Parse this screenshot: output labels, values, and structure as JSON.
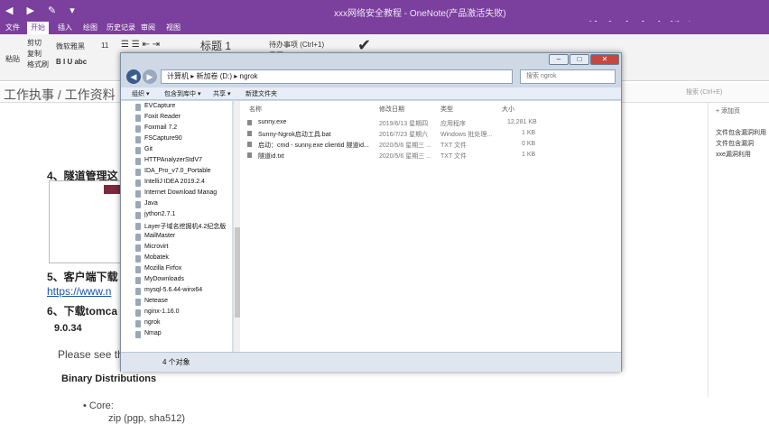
{
  "onenote": {
    "title": "xxx网络安全教程 - OneNote(产品激活失败)",
    "watermark": "网络安全官方教程",
    "tabs": [
      "文件",
      "开始",
      "插入",
      "绘图",
      "历史记录",
      "审阅",
      "视图"
    ],
    "ribbon": {
      "paste": "粘贴",
      "cut": "剪切",
      "copy": "复制",
      "format_painter": "格式刷",
      "font": "微软雅黑",
      "size": "11",
      "heading": "标题 1",
      "todo": "待办事项 (Ctrl+1)",
      "important": "重要"
    },
    "breadcrumb": "工作执事 / 工作资料",
    "search_placeholder": "搜索 (Ctrl+E)",
    "right_pane": {
      "add_page": "+ 添加页",
      "items": [
        "文件包含漏洞利用",
        "文件包含漏洞",
        "xxe漏洞利用"
      ]
    },
    "note": {
      "item4": "4、隧道管理这",
      "item5": "5、客户端下载",
      "link": "https://www.n",
      "item6": "6、下载tomca",
      "version": "9.0.34",
      "please": "Please see the",
      "binary": "Binary Distributions",
      "core": "Core:",
      "zip": "zip (pgp, sha512)"
    }
  },
  "explorer": {
    "address": [
      "计算机",
      "新加卷 (D:)",
      "ngrok"
    ],
    "search_placeholder": "搜索 ngrok",
    "commands": [
      "组织 ▾",
      "包含到库中 ▾",
      "共享 ▾",
      "新建文件夹"
    ],
    "nav_items": [
      "EVCapture",
      "Foxit Reader",
      "Foxmail 7.2",
      "FSCapture90",
      "Git",
      "HTTPAnalyzerStdV7",
      "IDA_Pro_v7.0_Portable",
      "IntelliJ IDEA 2019.2.4",
      "Internet Download Manag",
      "Java",
      "jython2.7.1",
      "Layer子域名挖掘机4.2纪念版",
      "MailMaster",
      "Microvirt",
      "Mobatek",
      "Mozilla Firfox",
      "MyDownloads",
      "mysql-5.6.44-winx64",
      "Netease",
      "nginx-1.16.0",
      "ngrok",
      "Nmap"
    ],
    "columns": {
      "name": "名称",
      "date": "修改日期",
      "type": "类型",
      "size": "大小"
    },
    "files": [
      {
        "name": "sunny.exe",
        "date": "2019/6/13 星期四",
        "type": "应用程序",
        "size": "12,281 KB"
      },
      {
        "name": "Sunny-Ngrok启动工具.bat",
        "date": "2016/7/23 星期六",
        "type": "Windows 批处理...",
        "size": "1 KB"
      },
      {
        "name": "启动：cmd - sunny.exe clientid 隧道id...",
        "date": "2020/5/6 星期三 ...",
        "type": "TXT 文件",
        "size": "0 KB"
      },
      {
        "name": "隧道id.txt",
        "date": "2020/5/6 星期三 ...",
        "type": "TXT 文件",
        "size": "1 KB"
      }
    ],
    "status": "4 个对象"
  }
}
